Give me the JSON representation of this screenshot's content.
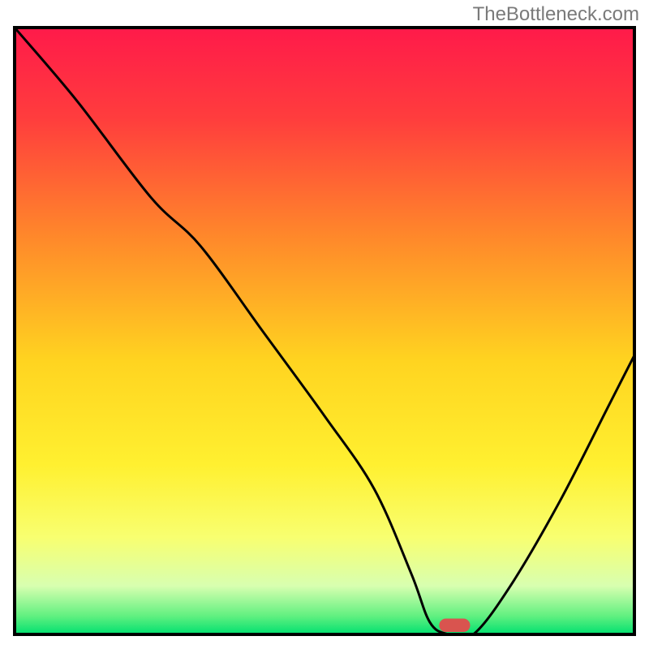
{
  "watermark": "TheBottleneck.com",
  "chart_data": {
    "type": "line",
    "title": "",
    "xlabel": "",
    "ylabel": "",
    "xlim": [
      0,
      100
    ],
    "ylim": [
      0,
      100
    ],
    "background_gradient": {
      "stops": [
        {
          "offset": 0.0,
          "color": "#ff1a4a"
        },
        {
          "offset": 0.15,
          "color": "#ff3d3d"
        },
        {
          "offset": 0.35,
          "color": "#ff8a2a"
        },
        {
          "offset": 0.55,
          "color": "#ffd420"
        },
        {
          "offset": 0.72,
          "color": "#fff030"
        },
        {
          "offset": 0.84,
          "color": "#f8ff70"
        },
        {
          "offset": 0.92,
          "color": "#d8ffb0"
        },
        {
          "offset": 0.97,
          "color": "#60f080"
        },
        {
          "offset": 1.0,
          "color": "#00e070"
        }
      ]
    },
    "series": [
      {
        "name": "bottleneck-curve",
        "color": "#000000",
        "x": [
          0,
          10,
          22,
          30,
          40,
          50,
          58,
          64,
          67,
          70,
          74,
          80,
          88,
          96,
          100
        ],
        "y": [
          100,
          88,
          72,
          64,
          50,
          36,
          24,
          10,
          2,
          0,
          0,
          8,
          22,
          38,
          46
        ]
      }
    ],
    "marker": {
      "name": "optimal-point",
      "x": 71,
      "y": 1.5,
      "width": 5,
      "height": 2.2,
      "color": "#d9544f"
    },
    "frame": {
      "color": "#000000",
      "width": 4
    }
  }
}
